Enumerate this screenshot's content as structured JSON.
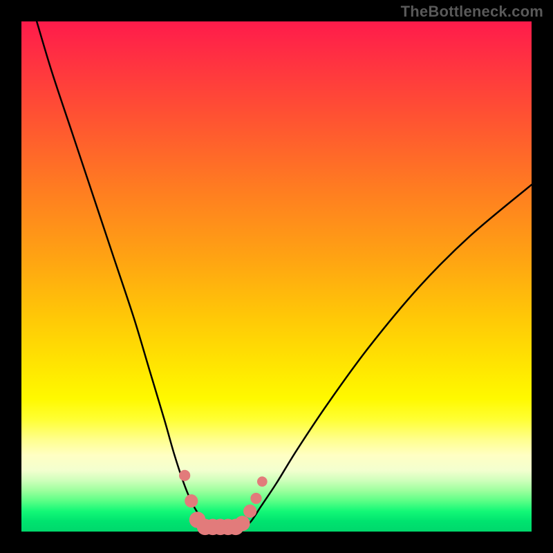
{
  "watermark": "TheBottleneck.com",
  "chart_data": {
    "type": "line",
    "title": "",
    "xlabel": "",
    "ylabel": "",
    "xlim": [
      0,
      100
    ],
    "ylim": [
      0,
      100
    ],
    "series": [
      {
        "name": "left-curve",
        "x": [
          3,
          6,
          10,
          14,
          18,
          22,
          25,
          28,
          30,
          32,
          33.5,
          35,
          36.5,
          38
        ],
        "values": [
          100,
          90,
          78,
          66,
          54,
          42,
          32,
          22,
          15,
          9,
          5.5,
          3,
          1.2,
          0
        ]
      },
      {
        "name": "right-curve",
        "x": [
          43,
          45,
          47,
          50,
          54,
          60,
          68,
          78,
          88,
          100
        ],
        "values": [
          0,
          2,
          5,
          9.5,
          16,
          25,
          36,
          48,
          58,
          68
        ]
      }
    ],
    "markers": {
      "name": "salmon-dots",
      "color": "#e27b7b",
      "points": [
        {
          "x": 32.0,
          "y": 11.0,
          "r": 1.1
        },
        {
          "x": 33.3,
          "y": 6.0,
          "r": 1.3
        },
        {
          "x": 34.5,
          "y": 2.3,
          "r": 1.6
        },
        {
          "x": 36.0,
          "y": 0.9,
          "r": 1.6
        },
        {
          "x": 37.5,
          "y": 0.9,
          "r": 1.6
        },
        {
          "x": 39.0,
          "y": 0.9,
          "r": 1.6
        },
        {
          "x": 40.5,
          "y": 0.9,
          "r": 1.6
        },
        {
          "x": 42.0,
          "y": 0.9,
          "r": 1.6
        },
        {
          "x": 43.3,
          "y": 1.6,
          "r": 1.5
        },
        {
          "x": 44.8,
          "y": 4.0,
          "r": 1.3
        },
        {
          "x": 46.0,
          "y": 6.5,
          "r": 1.1
        },
        {
          "x": 47.2,
          "y": 9.8,
          "r": 1.0
        }
      ]
    },
    "colors": {
      "curve": "#000000",
      "marker": "#e27b7b",
      "frame_bg": "#000000"
    }
  }
}
